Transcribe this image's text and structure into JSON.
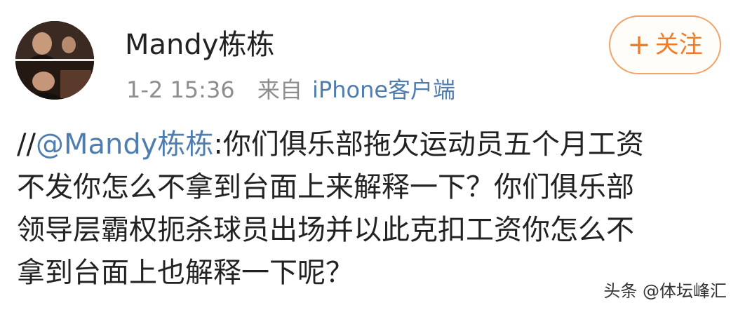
{
  "post": {
    "username": "Mandy栋栋",
    "timestamp": "1-2 15:36",
    "source_prefix": "来自",
    "source_client": "iPhone客户端",
    "follow_plus": "+",
    "follow_label": "关注",
    "body": {
      "repost_slashes": "//",
      "mention": "@Mandy栋栋",
      "line1_rest": ":你们俱乐部拖欠运动员五个月工资",
      "line2": "不发你怎么不拿到台面上来解释一下？你们俱乐部",
      "line3": "领导层霸权扼杀球员出场并以此克扣工资你怎么不",
      "line4": "拿到台面上也解释一下呢？"
    }
  },
  "watermark": "头条 @体坛峰汇",
  "colors": {
    "mention": "#507daf",
    "follow_accent": "#f07c27",
    "meta_gray": "#8e8e8e",
    "text": "#222222"
  },
  "icons": {
    "avatar": "user-avatar-photo"
  }
}
